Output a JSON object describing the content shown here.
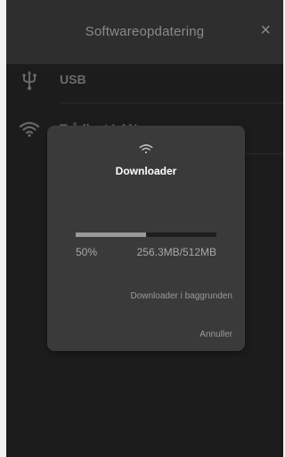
{
  "header": {
    "title": "Softwareopdatering",
    "close_label": "×"
  },
  "sources": [
    {
      "label": "USB",
      "icon": "usb-icon"
    },
    {
      "label": "Trådløst LAN",
      "icon": "wifi-icon"
    }
  ],
  "dialog": {
    "icon": "wifi-icon",
    "title": "Downloader",
    "progress": {
      "percent_label": "50%",
      "fraction": 0.5,
      "size_label": "256.3MB/512MB"
    },
    "background_button": "Downloader i baggrunden",
    "cancel_button": "Annuller"
  },
  "colors": {
    "panel": "#262626",
    "dialog": "#3a3a3a",
    "progress_fill": "#9a9a9a"
  }
}
